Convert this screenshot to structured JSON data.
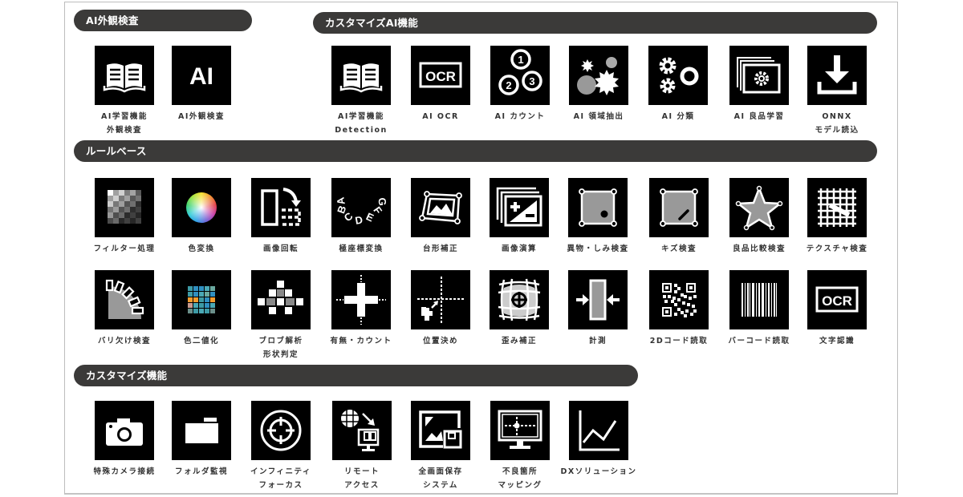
{
  "sections": {
    "ai_inspection": {
      "title": "AI外観検査",
      "items": [
        {
          "icon": "book-icon",
          "line1": "AI学習機能",
          "line2": "外観検査"
        },
        {
          "icon": "ai-text-icon",
          "line1": "AI外観検査",
          "line2": ""
        }
      ]
    },
    "custom_ai": {
      "title": "カスタマイズAI機能",
      "items": [
        {
          "icon": "book-icon",
          "line1": "AI学習機能",
          "line2": "Detection"
        },
        {
          "icon": "ocr-icon",
          "line1": "AI OCR",
          "line2": ""
        },
        {
          "icon": "numbered-circles-icon",
          "line1": "AI カウント",
          "line2": ""
        },
        {
          "icon": "region-extract-icon",
          "line1": "AI 領域抽出",
          "line2": ""
        },
        {
          "icon": "gears-icon",
          "line1": "AI 分類",
          "line2": ""
        },
        {
          "icon": "stacked-images-gear-icon",
          "line1": "AI 良品学習",
          "line2": ""
        },
        {
          "icon": "download-icon",
          "line1": "ONNX",
          "line2": "モデル読込"
        }
      ]
    },
    "rule_based": {
      "title": "ルールベース",
      "items": [
        {
          "icon": "checker-filter-icon",
          "line1": "フィルター処理",
          "line2": ""
        },
        {
          "icon": "color-wheel-icon",
          "line1": "色変換",
          "line2": ""
        },
        {
          "icon": "rotate-image-icon",
          "line1": "画像回転",
          "line2": ""
        },
        {
          "icon": "polar-text-icon",
          "line1": "極座標変換",
          "line2": ""
        },
        {
          "icon": "keystone-icon",
          "line1": "台形補正",
          "line2": ""
        },
        {
          "icon": "image-arithmetic-icon",
          "line1": "画像演算",
          "line2": ""
        },
        {
          "icon": "foreign-object-icon",
          "line1": "異物・しみ検査",
          "line2": ""
        },
        {
          "icon": "scratch-icon",
          "line1": "キズ検査",
          "line2": ""
        },
        {
          "icon": "star-compare-icon",
          "line1": "良品比較検査",
          "line2": ""
        },
        {
          "icon": "texture-grid-icon",
          "line1": "テクスチャ検査",
          "line2": ""
        },
        {
          "icon": "burr-chip-icon",
          "line1": "バリ欠け検査",
          "line2": ""
        },
        {
          "icon": "color-binarize-icon",
          "line1": "色二値化",
          "line2": ""
        },
        {
          "icon": "blob-analysis-icon",
          "line1": "ブロブ解析",
          "line2": "形状判定"
        },
        {
          "icon": "presence-count-icon",
          "line1": "有無・カウント",
          "line2": ""
        },
        {
          "icon": "positioning-icon",
          "line1": "位置決め",
          "line2": ""
        },
        {
          "icon": "distortion-correct-icon",
          "line1": "歪み補正",
          "line2": ""
        },
        {
          "icon": "measure-icon",
          "line1": "計測",
          "line2": ""
        },
        {
          "icon": "qr-code-icon",
          "line1": "2Dコード読取",
          "line2": ""
        },
        {
          "icon": "barcode-icon",
          "line1": "バーコード読取",
          "line2": ""
        },
        {
          "icon": "ocr-icon",
          "line1": "文字認識",
          "line2": ""
        }
      ]
    },
    "custom": {
      "title": "カスタマイズ機能",
      "items": [
        {
          "icon": "camera-icon",
          "line1": "特殊カメラ接続",
          "line2": ""
        },
        {
          "icon": "folder-icon",
          "line1": "フォルダ監視",
          "line2": ""
        },
        {
          "icon": "crosshair-icon",
          "line1": "インフィニティ",
          "line2": "フォーカス"
        },
        {
          "icon": "remote-access-icon",
          "line1": "リモート",
          "line2": "アクセス"
        },
        {
          "icon": "save-image-icon",
          "line1": "全画面保存",
          "line2": "システム"
        },
        {
          "icon": "monitor-mapping-icon",
          "line1": "不良箇所",
          "line2": "マッピング"
        },
        {
          "icon": "line-chart-icon",
          "line1": "DXソリューション",
          "line2": ""
        }
      ]
    }
  },
  "ocr_text": "OCR",
  "ai_text": "AI",
  "colors": {
    "pill": "#3b3a39",
    "tile": "#000000",
    "label": "#333333"
  }
}
